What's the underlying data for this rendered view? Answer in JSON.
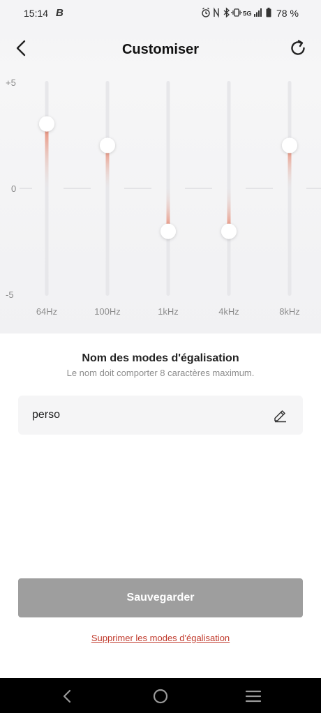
{
  "status_bar": {
    "time": "15:14",
    "app_glyph": "B",
    "battery": "78 %",
    "icons": [
      "alarm-icon",
      "nfc-icon",
      "bluetooth-icon",
      "vibrate-icon",
      "5g-icon",
      "signal-icon",
      "battery-icon"
    ],
    "network": "5G"
  },
  "header": {
    "title": "Customiser",
    "back_icon": "chevron-left-icon",
    "reset_icon": "refresh-icon"
  },
  "equalizer": {
    "db_labels": {
      "max": "+5",
      "mid": "0",
      "min": "-5"
    },
    "range": [
      -5,
      5
    ],
    "accent_color": "#e8826a",
    "bands": [
      {
        "label": "64Hz",
        "value": 3
      },
      {
        "label": "100Hz",
        "value": 2
      },
      {
        "label": "1kHz",
        "value": -2
      },
      {
        "label": "4kHz",
        "value": -2
      },
      {
        "label": "8kHz",
        "value": 2
      }
    ]
  },
  "name_section": {
    "title": "Nom des modes d'égalisation",
    "subtitle": "Le nom doit comporter 8 caractères maximum.",
    "value": "perso",
    "edit_icon": "pencil-icon"
  },
  "actions": {
    "save_label": "Sauvegarder",
    "delete_label": "Supprimer les modes d'égalisation"
  },
  "nav_bar": {
    "icons": [
      "back-icon",
      "home-icon",
      "recents-icon"
    ]
  }
}
